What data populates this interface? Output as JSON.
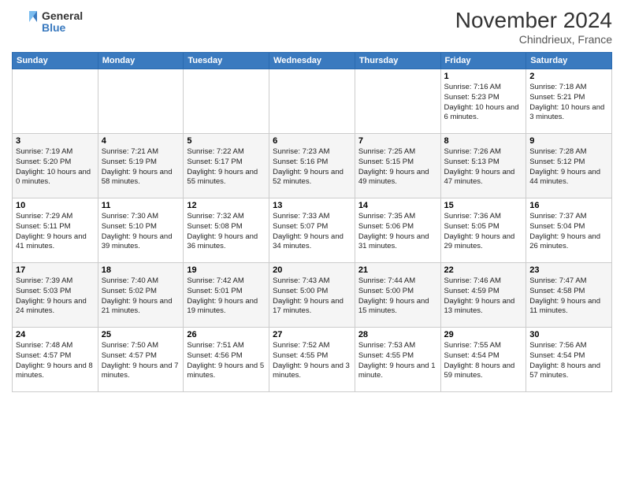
{
  "header": {
    "logo_line1": "General",
    "logo_line2": "Blue",
    "month": "November 2024",
    "location": "Chindrieux, France"
  },
  "weekdays": [
    "Sunday",
    "Monday",
    "Tuesday",
    "Wednesday",
    "Thursday",
    "Friday",
    "Saturday"
  ],
  "weeks": [
    [
      {
        "day": "",
        "info": ""
      },
      {
        "day": "",
        "info": ""
      },
      {
        "day": "",
        "info": ""
      },
      {
        "day": "",
        "info": ""
      },
      {
        "day": "",
        "info": ""
      },
      {
        "day": "1",
        "info": "Sunrise: 7:16 AM\nSunset: 5:23 PM\nDaylight: 10 hours and 6 minutes."
      },
      {
        "day": "2",
        "info": "Sunrise: 7:18 AM\nSunset: 5:21 PM\nDaylight: 10 hours and 3 minutes."
      }
    ],
    [
      {
        "day": "3",
        "info": "Sunrise: 7:19 AM\nSunset: 5:20 PM\nDaylight: 10 hours and 0 minutes."
      },
      {
        "day": "4",
        "info": "Sunrise: 7:21 AM\nSunset: 5:19 PM\nDaylight: 9 hours and 58 minutes."
      },
      {
        "day": "5",
        "info": "Sunrise: 7:22 AM\nSunset: 5:17 PM\nDaylight: 9 hours and 55 minutes."
      },
      {
        "day": "6",
        "info": "Sunrise: 7:23 AM\nSunset: 5:16 PM\nDaylight: 9 hours and 52 minutes."
      },
      {
        "day": "7",
        "info": "Sunrise: 7:25 AM\nSunset: 5:15 PM\nDaylight: 9 hours and 49 minutes."
      },
      {
        "day": "8",
        "info": "Sunrise: 7:26 AM\nSunset: 5:13 PM\nDaylight: 9 hours and 47 minutes."
      },
      {
        "day": "9",
        "info": "Sunrise: 7:28 AM\nSunset: 5:12 PM\nDaylight: 9 hours and 44 minutes."
      }
    ],
    [
      {
        "day": "10",
        "info": "Sunrise: 7:29 AM\nSunset: 5:11 PM\nDaylight: 9 hours and 41 minutes."
      },
      {
        "day": "11",
        "info": "Sunrise: 7:30 AM\nSunset: 5:10 PM\nDaylight: 9 hours and 39 minutes."
      },
      {
        "day": "12",
        "info": "Sunrise: 7:32 AM\nSunset: 5:08 PM\nDaylight: 9 hours and 36 minutes."
      },
      {
        "day": "13",
        "info": "Sunrise: 7:33 AM\nSunset: 5:07 PM\nDaylight: 9 hours and 34 minutes."
      },
      {
        "day": "14",
        "info": "Sunrise: 7:35 AM\nSunset: 5:06 PM\nDaylight: 9 hours and 31 minutes."
      },
      {
        "day": "15",
        "info": "Sunrise: 7:36 AM\nSunset: 5:05 PM\nDaylight: 9 hours and 29 minutes."
      },
      {
        "day": "16",
        "info": "Sunrise: 7:37 AM\nSunset: 5:04 PM\nDaylight: 9 hours and 26 minutes."
      }
    ],
    [
      {
        "day": "17",
        "info": "Sunrise: 7:39 AM\nSunset: 5:03 PM\nDaylight: 9 hours and 24 minutes."
      },
      {
        "day": "18",
        "info": "Sunrise: 7:40 AM\nSunset: 5:02 PM\nDaylight: 9 hours and 21 minutes."
      },
      {
        "day": "19",
        "info": "Sunrise: 7:42 AM\nSunset: 5:01 PM\nDaylight: 9 hours and 19 minutes."
      },
      {
        "day": "20",
        "info": "Sunrise: 7:43 AM\nSunset: 5:00 PM\nDaylight: 9 hours and 17 minutes."
      },
      {
        "day": "21",
        "info": "Sunrise: 7:44 AM\nSunset: 5:00 PM\nDaylight: 9 hours and 15 minutes."
      },
      {
        "day": "22",
        "info": "Sunrise: 7:46 AM\nSunset: 4:59 PM\nDaylight: 9 hours and 13 minutes."
      },
      {
        "day": "23",
        "info": "Sunrise: 7:47 AM\nSunset: 4:58 PM\nDaylight: 9 hours and 11 minutes."
      }
    ],
    [
      {
        "day": "24",
        "info": "Sunrise: 7:48 AM\nSunset: 4:57 PM\nDaylight: 9 hours and 8 minutes."
      },
      {
        "day": "25",
        "info": "Sunrise: 7:50 AM\nSunset: 4:57 PM\nDaylight: 9 hours and 7 minutes."
      },
      {
        "day": "26",
        "info": "Sunrise: 7:51 AM\nSunset: 4:56 PM\nDaylight: 9 hours and 5 minutes."
      },
      {
        "day": "27",
        "info": "Sunrise: 7:52 AM\nSunset: 4:55 PM\nDaylight: 9 hours and 3 minutes."
      },
      {
        "day": "28",
        "info": "Sunrise: 7:53 AM\nSunset: 4:55 PM\nDaylight: 9 hours and 1 minute."
      },
      {
        "day": "29",
        "info": "Sunrise: 7:55 AM\nSunset: 4:54 PM\nDaylight: 8 hours and 59 minutes."
      },
      {
        "day": "30",
        "info": "Sunrise: 7:56 AM\nSunset: 4:54 PM\nDaylight: 8 hours and 57 minutes."
      }
    ]
  ]
}
